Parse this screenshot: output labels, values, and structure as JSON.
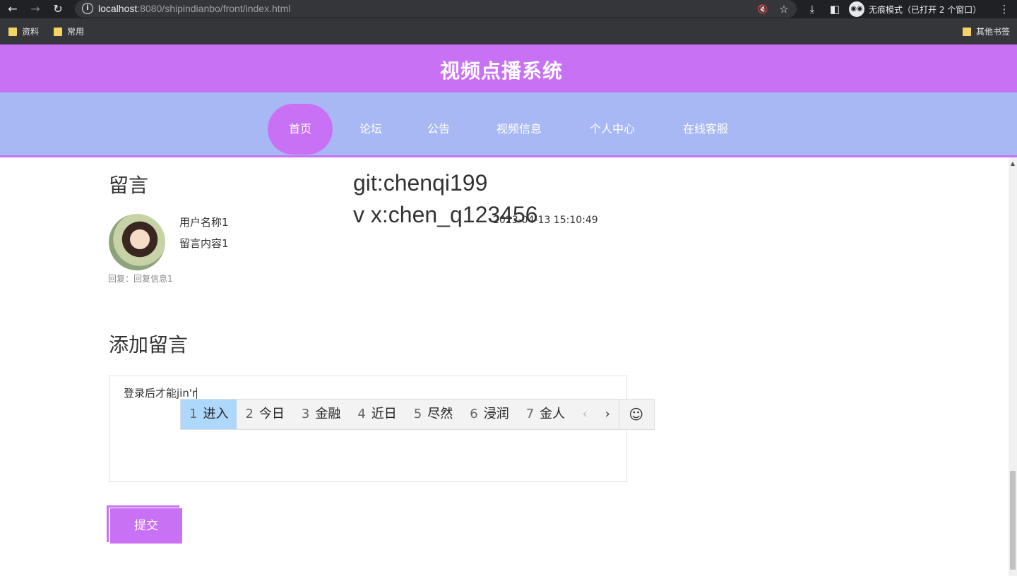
{
  "browser": {
    "url_host": "localhost",
    "url_rest": ":8080/shipindianbo/front/index.html",
    "incognito_label": "无痕模式（已打开 2 个窗口）",
    "bookmarks": [
      "资料",
      "常用"
    ],
    "other_bookmarks": "其他书签"
  },
  "header": {
    "title": "视频点播系统"
  },
  "nav": {
    "items": [
      {
        "label": "首页",
        "active": true
      },
      {
        "label": "论坛"
      },
      {
        "label": "公告"
      },
      {
        "label": "视频信息"
      },
      {
        "label": "个人中心"
      },
      {
        "label": "在线客服"
      }
    ]
  },
  "messages": {
    "title": "留言",
    "items": [
      {
        "username": "用户名称1",
        "content": "留言内容1",
        "time": "2023-04-13 15:10:49",
        "reply": "回复：回复信息1"
      }
    ]
  },
  "watermark": {
    "line1": "git:chenqi199",
    "line2": "v x:chen_q123456"
  },
  "add_message": {
    "title": "添加留言",
    "input_value": "登录后才能jin'r",
    "submit_label": "提交"
  },
  "ime": {
    "candidates": [
      {
        "n": "1",
        "text": "进入"
      },
      {
        "n": "2",
        "text": "今日"
      },
      {
        "n": "3",
        "text": "金融"
      },
      {
        "n": "4",
        "text": "近日"
      },
      {
        "n": "5",
        "text": "尽然"
      },
      {
        "n": "6",
        "text": "浸润"
      },
      {
        "n": "7",
        "text": "金人"
      }
    ],
    "selected_index": 0
  }
}
